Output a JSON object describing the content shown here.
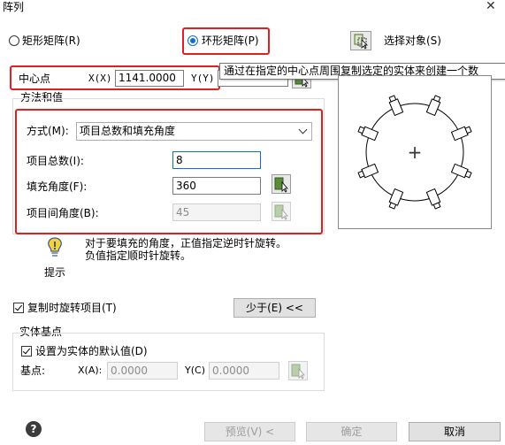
{
  "window": {
    "title": "阵列",
    "close_glyph": "✕"
  },
  "array_type": {
    "rect_label": "矩形矩阵(R)",
    "polar_label": "环形矩阵(P)",
    "selected": "polar"
  },
  "select_objects": {
    "label": "选择对象(S)",
    "icon": "select-objects-icon"
  },
  "tooltip": {
    "text": "通过在指定的中心点周围复制选定的实体来创建一个数"
  },
  "center_point": {
    "label": "中心点",
    "x_label": "X(X)",
    "x_value": "1141.0000",
    "y_label": "Y(Y)"
  },
  "method": {
    "group_title": "方法和值",
    "mode_label": "方式(M):",
    "mode_value": "项目总数和填充角度",
    "total_items_label": "项目总数(I):",
    "total_items_value": "8",
    "fill_angle_label": "填充角度(F):",
    "fill_angle_value": "360",
    "item_angle_label": "项目间角度(B):",
    "item_angle_value": "45"
  },
  "hint": {
    "caption": "提示",
    "line1": "对于要填充的角度，正值指定逆时针旋转。",
    "line2": "负值指定顺时针旋转。",
    "icon": "lightbulb-icon"
  },
  "preview": {
    "item_count": 8,
    "fill_angle_deg": 360,
    "center_mark": "+"
  },
  "rotate_items": {
    "label": "复制时旋转项目(T)",
    "checked": true
  },
  "less_button": {
    "label": "少于(E) <<"
  },
  "base_point": {
    "group_title": "实体基点",
    "default_label": "设置为实体的默认值(D)",
    "default_checked": true,
    "label": "基点:",
    "x_label": "X(A):",
    "x_value": "0.0000",
    "y_label": "Y(C)",
    "y_value": "0.0000"
  },
  "footer": {
    "help_glyph": "?",
    "preview_label": "预览(V) <",
    "ok_label": "确定",
    "cancel_label": "取消"
  },
  "colors": {
    "highlight": "#e0201c",
    "accent": "#0b6fd4"
  }
}
